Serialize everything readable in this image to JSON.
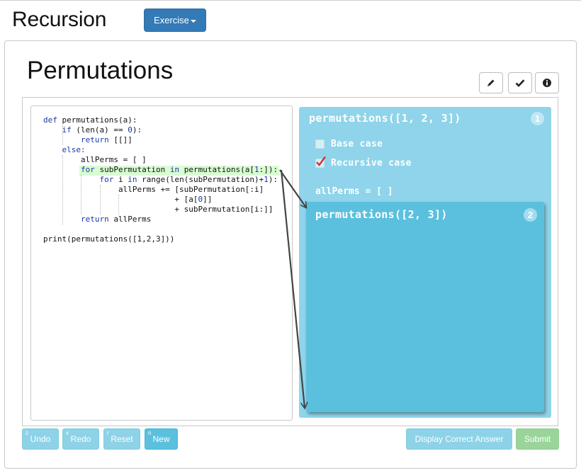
{
  "header": {
    "title": "Recursion",
    "exercise_label": "Exercise"
  },
  "exercise": {
    "title": "Permutations"
  },
  "toolbar": {
    "icons": [
      "pencil-icon",
      "check-icon",
      "info-icon"
    ]
  },
  "code": {
    "lines": [
      [
        {
          "t": "def ",
          "c": "kw"
        },
        {
          "t": "permutations(a):"
        }
      ],
      [
        {
          "t": "    "
        },
        {
          "t": "if ",
          "c": "kw"
        },
        {
          "t": "(len(a) == "
        },
        {
          "t": "0",
          "c": "num"
        },
        {
          "t": "):"
        }
      ],
      [
        {
          "t": "        "
        },
        {
          "t": "return ",
          "c": "kw"
        },
        {
          "t": "[[]]"
        }
      ],
      [
        {
          "t": "    "
        },
        {
          "t": "else:",
          "c": "kw"
        }
      ],
      [
        {
          "t": "        allPerms = [ ]"
        }
      ],
      [
        {
          "t": "        "
        },
        {
          "t": "for ",
          "c": "kw"
        },
        {
          "t": "subPermutation "
        },
        {
          "t": "in ",
          "c": "kw"
        },
        {
          "t": "permutations(a["
        },
        {
          "t": "1",
          "c": "num"
        },
        {
          "t": ":]):"
        }
      ],
      [
        {
          "t": "            "
        },
        {
          "t": "for ",
          "c": "kw"
        },
        {
          "t": "i "
        },
        {
          "t": "in ",
          "c": "kw"
        },
        {
          "t": "range(len(subPermutation)+"
        },
        {
          "t": "1",
          "c": "num"
        },
        {
          "t": "):"
        }
      ],
      [
        {
          "t": "                allPerms += [subPermutation[:i]"
        }
      ],
      [
        {
          "t": "                            + [a["
        },
        {
          "t": "0",
          "c": "num"
        },
        {
          "t": "]]"
        }
      ],
      [
        {
          "t": "                            + subPermutation[i:]]"
        }
      ],
      [
        {
          "t": "        "
        },
        {
          "t": "return ",
          "c": "kw"
        },
        {
          "t": "allPerms"
        }
      ],
      [
        {
          "t": ""
        }
      ],
      [
        {
          "t": "print(permutations([1,2,3]))"
        }
      ]
    ]
  },
  "frames": [
    {
      "title": "permutations([1, 2, 3])",
      "number": "1",
      "base_case_label": "Base case",
      "recursive_case_label": "Recursive case",
      "base_case_checked": false,
      "recursive_case_checked": true,
      "variable": "allPerms = [ ]"
    },
    {
      "title": "permutations([2, 3])",
      "number": "2"
    }
  ],
  "buttons": {
    "undo": {
      "label": "Undo",
      "shortcut": "z"
    },
    "redo": {
      "label": "Redo",
      "shortcut": "x"
    },
    "reset": {
      "label": "Reset",
      "shortcut": "r"
    },
    "new": {
      "label": "New",
      "shortcut": "n"
    },
    "display_correct": {
      "label": "Display Correct Answer"
    },
    "submit": {
      "label": "Submit"
    }
  },
  "colors": {
    "primary": "#337ab7",
    "frame_outer": "#8fd4ea",
    "frame_inner": "#5bc0de",
    "highlight": "#d9fcd2",
    "keyword": "#1a37a8",
    "check_red": "#d9302c"
  }
}
